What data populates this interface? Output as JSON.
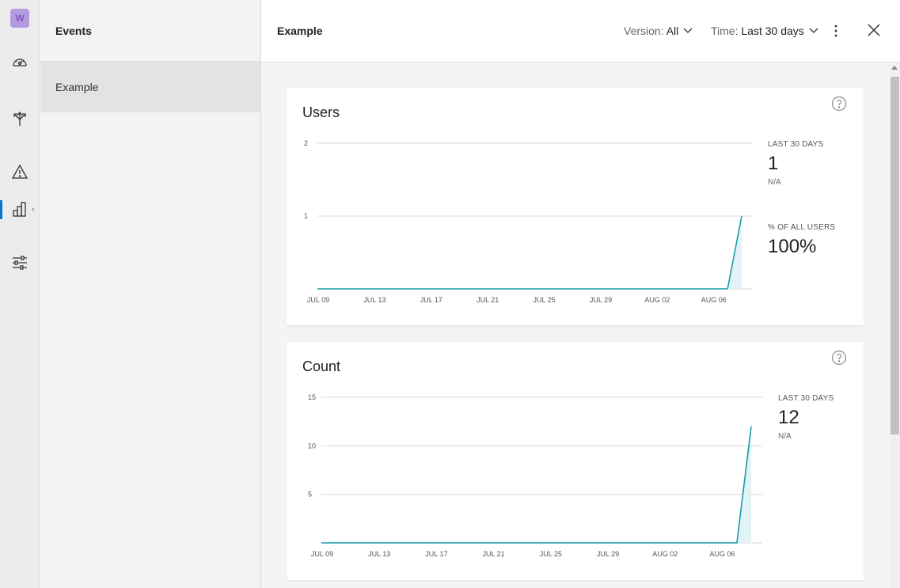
{
  "rail": {
    "app_badge": "W",
    "icons": [
      "speedometer-icon",
      "branch-arrows-icon",
      "warning-triangle-icon",
      "bar-chart-icon",
      "sliders-icon"
    ],
    "active_item": "bar-chart-icon",
    "accent_color": "#0078d4"
  },
  "list_panel": {
    "title": "Events",
    "items": [
      {
        "label": "Example",
        "selected": true
      }
    ]
  },
  "header": {
    "title": "Example",
    "version_filter": {
      "label": "Version:",
      "value": "All"
    },
    "time_filter": {
      "label": "Time:",
      "value": "Last 30 days"
    }
  },
  "cards": [
    {
      "title": "Users",
      "stats": [
        {
          "label": "LAST 30 DAYS",
          "value": "1",
          "sub": "N/A"
        },
        {
          "label": "% OF ALL USERS",
          "value": "100%",
          "sub": ""
        }
      ]
    },
    {
      "title": "Count",
      "stats": [
        {
          "label": "LAST 30 DAYS",
          "value": "12",
          "sub": "N/A"
        }
      ]
    }
  ],
  "chart_data": [
    {
      "type": "area",
      "title": "Users",
      "xlabel": "",
      "ylabel": "",
      "x_ticks": [
        "JUL 09",
        "JUL 13",
        "JUL 17",
        "JUL 21",
        "JUL 25",
        "JUL 29",
        "AUG 02",
        "AUG 06"
      ],
      "y_ticks": [
        1,
        2
      ],
      "ylim": [
        0,
        2
      ],
      "xlim": [
        "2024-07-09",
        "2024-08-08"
      ],
      "grid": true,
      "color": "#1a9ba8",
      "series": [
        {
          "x": [
            "2024-07-09",
            "2024-08-07",
            "2024-08-08"
          ],
          "y": [
            0,
            0,
            1
          ]
        }
      ]
    },
    {
      "type": "area",
      "title": "Count",
      "xlabel": "",
      "ylabel": "",
      "x_ticks": [
        "JUL 09",
        "JUL 13",
        "JUL 17",
        "JUL 21",
        "JUL 25",
        "JUL 29",
        "AUG 02",
        "AUG 06"
      ],
      "y_ticks": [
        5,
        10,
        15
      ],
      "ylim": [
        0,
        15
      ],
      "xlim": [
        "2024-07-09",
        "2024-08-08"
      ],
      "grid": true,
      "color": "#1a9ba8",
      "series": [
        {
          "x": [
            "2024-07-09",
            "2024-08-07",
            "2024-08-08"
          ],
          "y": [
            0,
            0,
            12
          ]
        }
      ]
    }
  ]
}
